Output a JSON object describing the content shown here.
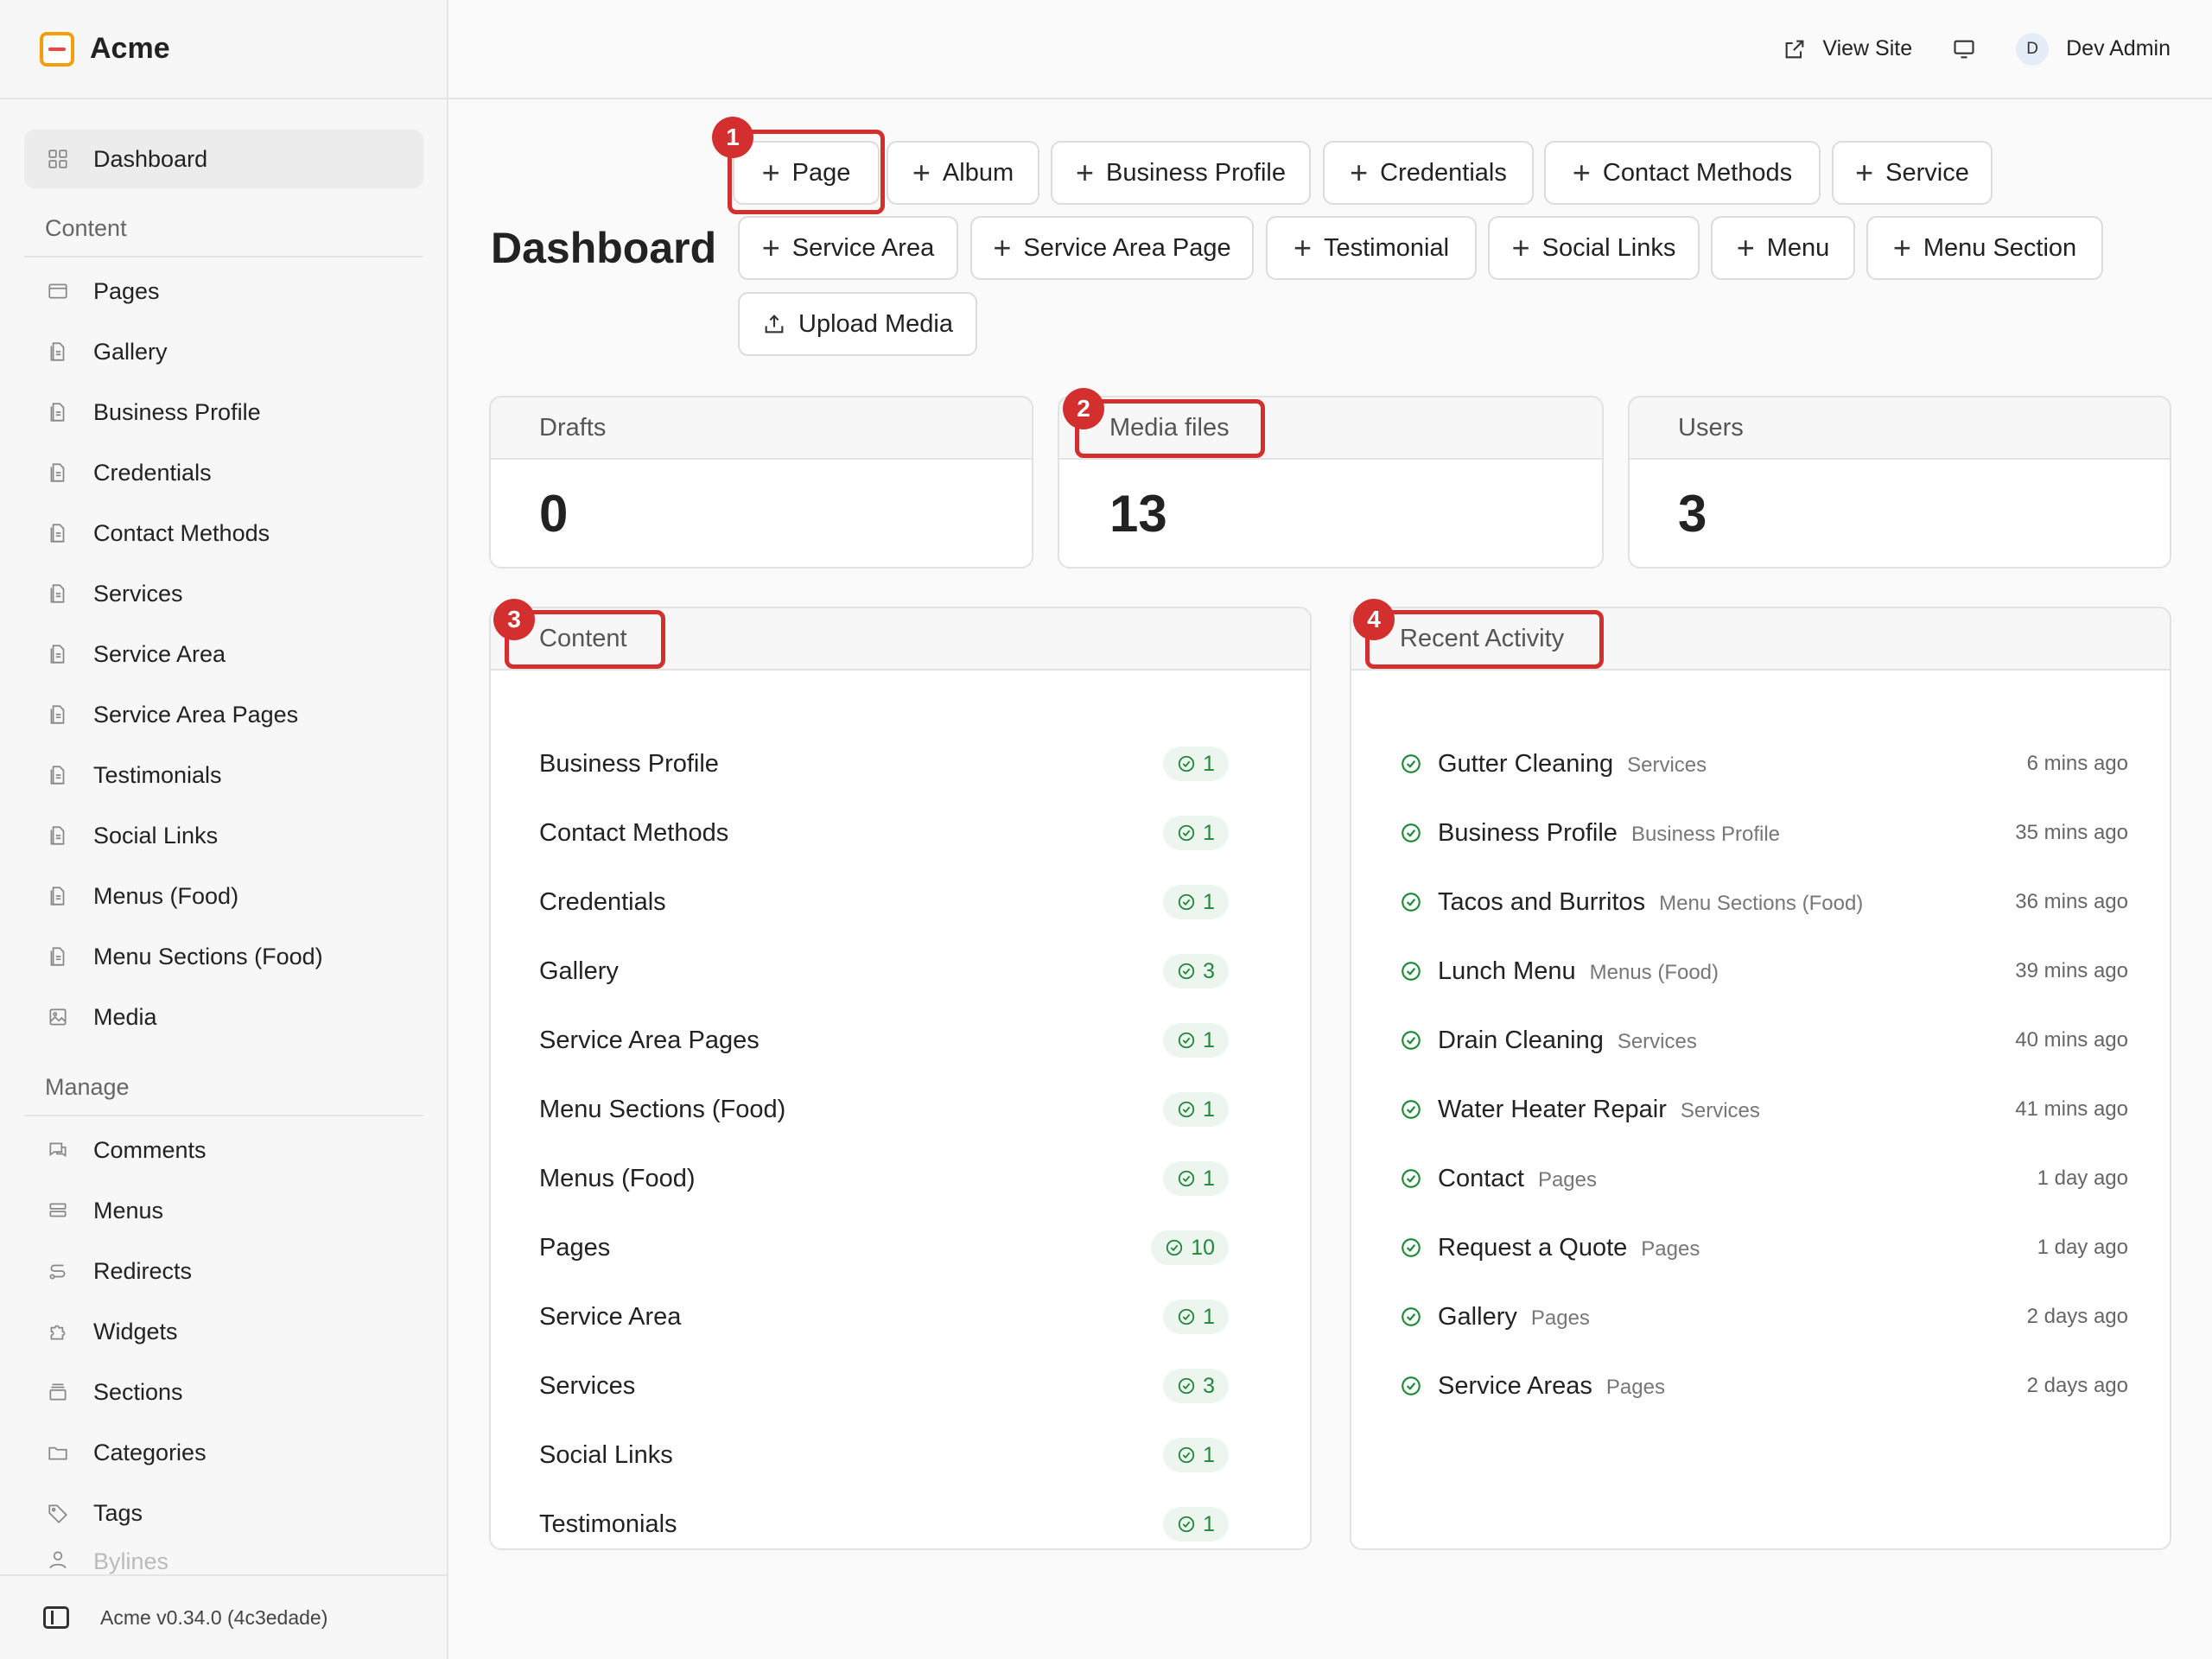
{
  "app": {
    "name": "Acme",
    "version": "Acme v0.34.0 (4c3edade)"
  },
  "topbar": {
    "view_site": "View Site",
    "avatar_initial": "D",
    "user_name": "Dev Admin"
  },
  "sidebar": {
    "dashboard": "Dashboard",
    "content_heading": "Content",
    "content_items": [
      "Pages",
      "Gallery",
      "Business Profile",
      "Credentials",
      "Contact Methods",
      "Services",
      "Service Area",
      "Service Area Pages",
      "Testimonials",
      "Social Links",
      "Menus (Food)",
      "Menu Sections (Food)",
      "Media"
    ],
    "manage_heading": "Manage",
    "manage_items": [
      "Comments",
      "Menus",
      "Redirects",
      "Widgets",
      "Sections",
      "Categories",
      "Tags",
      "Bylines"
    ]
  },
  "page_title": "Dashboard",
  "quick_actions": [
    "Page",
    "Album",
    "Business Profile",
    "Credentials",
    "Contact Methods",
    "Service",
    "Service Area",
    "Service Area Page",
    "Testimonial",
    "Social Links",
    "Menu",
    "Menu Section",
    "Upload Media"
  ],
  "stats": [
    {
      "label": "Drafts",
      "value": "0"
    },
    {
      "label": "Media files",
      "value": "13"
    },
    {
      "label": "Users",
      "value": "3"
    }
  ],
  "content_card": {
    "title": "Content",
    "rows": [
      {
        "label": "Business Profile",
        "count": "1"
      },
      {
        "label": "Contact Methods",
        "count": "1"
      },
      {
        "label": "Credentials",
        "count": "1"
      },
      {
        "label": "Gallery",
        "count": "3"
      },
      {
        "label": "Service Area Pages",
        "count": "1"
      },
      {
        "label": "Menu Sections (Food)",
        "count": "1"
      },
      {
        "label": "Menus (Food)",
        "count": "1"
      },
      {
        "label": "Pages",
        "count": "10"
      },
      {
        "label": "Service Area",
        "count": "1"
      },
      {
        "label": "Services",
        "count": "3"
      },
      {
        "label": "Social Links",
        "count": "1"
      },
      {
        "label": "Testimonials",
        "count": "1"
      }
    ]
  },
  "activity_card": {
    "title": "Recent Activity",
    "rows": [
      {
        "title": "Gutter Cleaning",
        "category": "Services",
        "time": "6 mins ago"
      },
      {
        "title": "Business Profile",
        "category": "Business Profile",
        "time": "35 mins ago"
      },
      {
        "title": "Tacos and Burritos",
        "category": "Menu Sections (Food)",
        "time": "36 mins ago"
      },
      {
        "title": "Lunch Menu",
        "category": "Menus (Food)",
        "time": "39 mins ago"
      },
      {
        "title": "Drain Cleaning",
        "category": "Services",
        "time": "40 mins ago"
      },
      {
        "title": "Water Heater Repair",
        "category": "Services",
        "time": "41 mins ago"
      },
      {
        "title": "Contact",
        "category": "Pages",
        "time": "1 day ago"
      },
      {
        "title": "Request a Quote",
        "category": "Pages",
        "time": "1 day ago"
      },
      {
        "title": "Gallery",
        "category": "Pages",
        "time": "2 days ago"
      },
      {
        "title": "Service Areas",
        "category": "Pages",
        "time": "2 days ago"
      }
    ]
  },
  "annotations": [
    "1",
    "2",
    "3",
    "4"
  ],
  "colors": {
    "accent_red": "#d32f2f",
    "status_green": "#1f8a3b",
    "logo_orange": "#f59e0b"
  }
}
